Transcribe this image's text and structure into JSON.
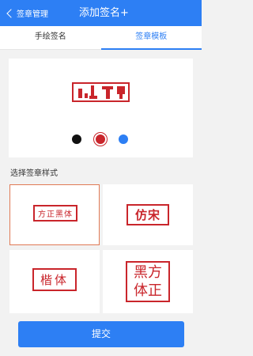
{
  "header": {
    "back_label": "签章管理",
    "title": "添加签名+"
  },
  "tabs": [
    {
      "label": "手绘签名",
      "active": false
    },
    {
      "label": "签章模板",
      "active": true
    }
  ],
  "preview": {
    "stamp_color": "#c9252b"
  },
  "colors": {
    "options": [
      "#111111",
      "#c9252b",
      "#2d7ff4"
    ],
    "selected": "#c9252b",
    "accent": "#2d7ff4"
  },
  "section_label": "选择签章样式",
  "styles": [
    {
      "text": "方正黑体",
      "selected": true
    },
    {
      "text": "仿宋",
      "selected": false
    },
    {
      "text": "楷体",
      "selected": false
    },
    {
      "text": "黑方\n体正",
      "selected": false
    }
  ],
  "submit_label": "提交"
}
